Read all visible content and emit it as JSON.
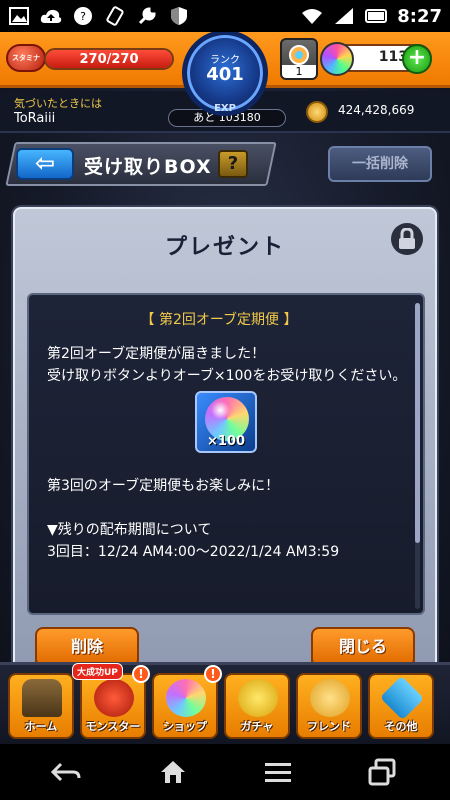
{
  "status_bar": {
    "time": "8:27"
  },
  "hud": {
    "stamina_icon_label": "スタミナ",
    "stamina_text": "270/270",
    "stamina_fill": 1.0,
    "rank_label": "ランク",
    "rank_value": "401",
    "exp_label": "EXP",
    "exp_remaining": "あと 103180",
    "gem_box_count": "1",
    "orb_count": "113",
    "plus_label": "+",
    "hint_label": "気づいたときには",
    "player_name": "ToRaiii",
    "coins": "424,428,669"
  },
  "header": {
    "back_label": "⇦",
    "title": "受け取りBOX",
    "help_label": "?",
    "bulk_delete_label": "一括削除"
  },
  "dialog": {
    "title": "プレゼント",
    "heading": "【 第2回オーブ定期便 】",
    "line1": "第2回オーブ定期便が届きました！",
    "line2": "受け取りボタンよりオーブ×100をお受け取りください。",
    "item_qty": "×100",
    "line3": "第3回のオーブ定期便もお楽しみに！",
    "period_heading": "▼残りの配布期間について",
    "period_line": "3回目：12/24 AM4:00〜2022/1/24 AM3:59",
    "delete_label": "削除",
    "close_label": "閉じる"
  },
  "bottom_nav": {
    "items": [
      {
        "label": "ホーム"
      },
      {
        "label": "モンスター"
      },
      {
        "label": "ショップ"
      },
      {
        "label": "ガチャ"
      },
      {
        "label": "フレンド"
      },
      {
        "label": "その他"
      }
    ],
    "monster_badge": "大成功UP",
    "alert_mark": "!"
  },
  "colors": {
    "accent_orange": "#f07a00",
    "dialog_bg": "#1e2438",
    "highlight_yellow": "#f0c84a"
  }
}
